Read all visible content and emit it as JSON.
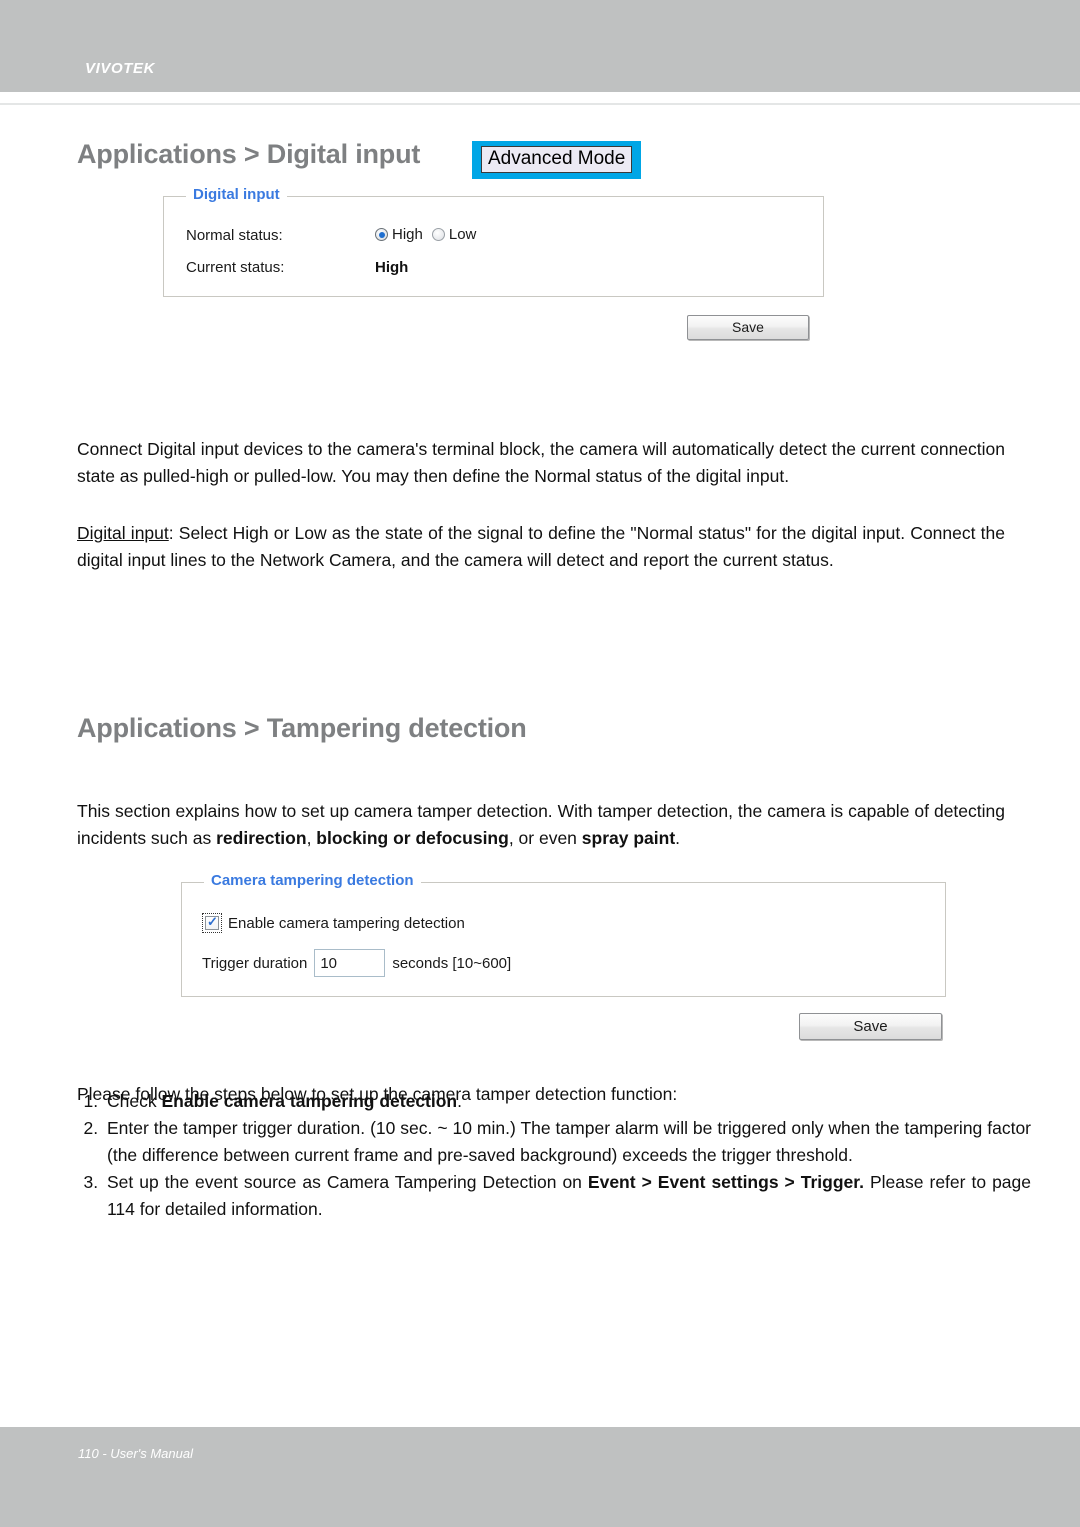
{
  "header": {
    "brand": "VIVOTEK"
  },
  "sections": {
    "digital_input": {
      "heading": "Applications > Digital input",
      "badge": "Advanced Mode",
      "panel": {
        "legend": "Digital input",
        "normal_status_label": "Normal status:",
        "radio_options": [
          {
            "label": "High",
            "selected": true
          },
          {
            "label": "Low",
            "selected": false
          }
        ],
        "current_status_label": "Current status:",
        "current_status_value": "High"
      },
      "save_label": "Save"
    },
    "tampering": {
      "heading": "Applications > Tampering detection",
      "panel": {
        "legend": "Camera tampering detection",
        "enable_label": "Enable camera tampering detection",
        "enable_checked": true,
        "duration_label": "Trigger duration",
        "duration_value": "10",
        "duration_hint": "seconds [10~600]"
      },
      "save_label": "Save"
    }
  },
  "body": {
    "para_connect_1": "Connect Digital input devices to the camera's terminal block, the camera will automatically detect the current connection state as pulled-high or pulled-low. You may then define the Normal status of the digital input.",
    "para_digital_input_term": "Digital input",
    "para_digital_input_rest": ": Select High or Low as the state of the signal to define the \"Normal status\" for the digital input. Connect the digital input lines to the Network Camera, and the camera will detect and report the current status.",
    "para_tamper_intro_1": "This section explains how to set up camera tamper detection. With tamper detection, the camera is capable of detecting incidents such as ",
    "para_tamper_bold_1": "redirection",
    "para_tamper_mid_1": ", ",
    "para_tamper_bold_2": "blocking or defocusing",
    "para_tamper_mid_2": ", or even ",
    "para_tamper_bold_3": "spray paint",
    "para_tamper_end": ".",
    "steps_intro": "Please follow the steps below to set up the camera tamper detection function:",
    "step_1_pre": "Check ",
    "step_1_bold": "Enable camera tampering detection",
    "step_1_post": ".",
    "step_2": "Enter the tamper trigger duration. (10 sec. ~ 10 min.) The tamper alarm will be triggered only when the tampering factor (the difference between current frame and pre-saved background) exceeds the trigger threshold.",
    "step_3_pre": "Set up the event source as Camera Tampering Detection on ",
    "step_3_bold_1": "Event > Event settings > Trigger.",
    "step_3_post": " Please refer to page 114 for detailed information."
  },
  "footer": {
    "text": "110 - User's Manual"
  },
  "colors": {
    "header_bar": "#bfc1c1",
    "heading_gray": "#7e8082",
    "legend_blue": "#3a7ae0",
    "badge_accent": "#00a6e6",
    "radio_selected": "#1f6fd0"
  }
}
